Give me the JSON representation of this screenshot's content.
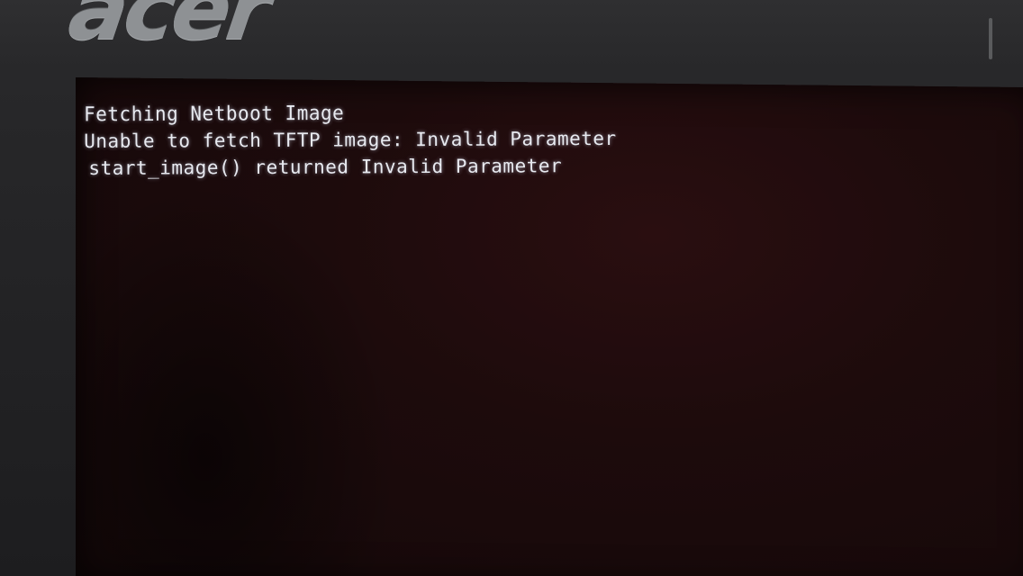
{
  "bezel": {
    "brand_logo": "acer"
  },
  "console": {
    "lines": [
      "Fetching Netboot Image",
      "Unable to fetch TFTP image: Invalid Parameter",
      "start_image() returned Invalid Parameter"
    ]
  },
  "colors": {
    "screen_background": "#140809",
    "console_text": "#e8eaf0",
    "bezel": "#28282a"
  }
}
